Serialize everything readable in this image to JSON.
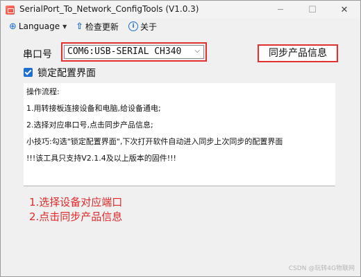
{
  "window": {
    "title": "SerialPort_To_Network_ConfigTools (V1.0.3)",
    "minimize_glyph": "─",
    "maximize_glyph": "☐",
    "close_glyph": "✕"
  },
  "menu": {
    "language_label": "Language",
    "update_label": "检查更新",
    "about_label": "关于"
  },
  "port": {
    "label": "串口号",
    "selected": "COM6:USB-SERIAL CH340"
  },
  "sync_button_label": "同步产品信息",
  "lock_config": {
    "label": "锁定配置界面",
    "checked": true
  },
  "instructions": [
    "操作流程:",
    "1.用转接板连接设备和电脑,给设备通电;",
    "2.选择对应串口号,点击同步产品信息;",
    "小技巧:勾选\"锁定配置界面\",下次打开软件自动进入同步上次同步的配置界面",
    "!!!该工具只支持V2.1.4及以上版本的固件!!!"
  ],
  "annotations": [
    "1.选择设备对应端口",
    "2.点击同步产品信息"
  ],
  "watermark": "CSDN @玩转4G物联网",
  "colors": {
    "accent": "#1e6fd0",
    "highlight": "#e23030"
  },
  "icons": [
    "app-icon",
    "globe-icon",
    "upload-icon",
    "info-icon",
    "chevron-down-icon",
    "checkbox-checked-icon"
  ]
}
